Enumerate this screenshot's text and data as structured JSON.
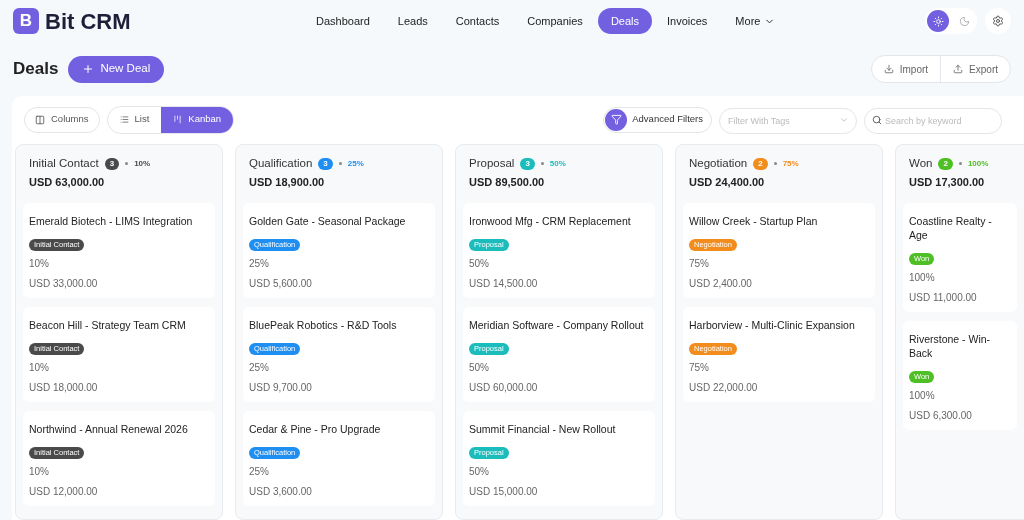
{
  "brand": {
    "logo_letter": "B",
    "name": "Bit CRM"
  },
  "nav": [
    {
      "label": "Dashboard",
      "selected": false
    },
    {
      "label": "Leads",
      "selected": false
    },
    {
      "label": "Contacts",
      "selected": false
    },
    {
      "label": "Companies",
      "selected": false
    },
    {
      "label": "Deals",
      "selected": true
    },
    {
      "label": "Invoices",
      "selected": false
    },
    {
      "label": "More",
      "selected": false,
      "kind": "dropdown"
    }
  ],
  "theme_toggle": [
    {
      "kind": "light",
      "selected": true
    },
    {
      "kind": "dark",
      "selected": false
    }
  ],
  "page_title": "Deals",
  "new_button": "New Deal",
  "actions": [
    "Import",
    "Export"
  ],
  "toolbar": {
    "columns_button": "Columns",
    "views": [
      {
        "label": "List",
        "kind": "list",
        "selected": false
      },
      {
        "label": "Kanban",
        "kind": "kanban",
        "selected": true
      }
    ],
    "advanced_filters": "Advanced Filters",
    "tag_filter": {
      "placeholder": "Filter With Tags"
    },
    "search": {
      "placeholder": "Search by keyword"
    }
  },
  "stages": [
    {
      "name": "Initial Contact",
      "count": "3",
      "probability": "10%",
      "total": "USD 63,000.00",
      "color": "#4a4a4a",
      "deals": [
        {
          "title": "Emerald Biotech - LIMS Integration",
          "stage": "Initial Contact",
          "probability": "10%",
          "amount": "USD 33,000.00"
        },
        {
          "title": "Beacon Hill - Strategy Team CRM",
          "stage": "Initial Contact",
          "probability": "10%",
          "amount": "USD 18,000.00"
        },
        {
          "title": "Northwind - Annual Renewal 2026",
          "stage": "Initial Contact",
          "probability": "10%",
          "amount": "USD 12,000.00"
        }
      ]
    },
    {
      "name": "Qualification",
      "count": "3",
      "probability": "25%",
      "total": "USD 18,900.00",
      "color": "#1e8ef0",
      "deals": [
        {
          "title": "Golden Gate - Seasonal Package",
          "stage": "Qualification",
          "probability": "25%",
          "amount": "USD 5,600.00"
        },
        {
          "title": "BluePeak Robotics - R&D Tools",
          "stage": "Qualification",
          "probability": "25%",
          "amount": "USD 9,700.00"
        },
        {
          "title": "Cedar & Pine - Pro Upgrade",
          "stage": "Qualification",
          "probability": "25%",
          "amount": "USD 3,600.00"
        }
      ]
    },
    {
      "name": "Proposal",
      "count": "3",
      "probability": "50%",
      "total": "USD 89,500.00",
      "color": "#1bbcbc",
      "deals": [
        {
          "title": "Ironwood Mfg - CRM Replacement",
          "stage": "Proposal",
          "probability": "50%",
          "amount": "USD 14,500.00"
        },
        {
          "title": "Meridian Software - Company Rollout",
          "stage": "Proposal",
          "probability": "50%",
          "amount": "USD 60,000.00"
        },
        {
          "title": "Summit Financial - New Rollout",
          "stage": "Proposal",
          "probability": "50%",
          "amount": "USD 15,000.00"
        }
      ]
    },
    {
      "name": "Negotiation",
      "count": "2",
      "probability": "75%",
      "total": "USD 24,400.00",
      "color": "#f28c1c",
      "deals": [
        {
          "title": "Willow Creek - Startup Plan",
          "stage": "Negotiation",
          "probability": "75%",
          "amount": "USD 2,400.00"
        },
        {
          "title": "Harborview - Multi-Clinic Expansion",
          "stage": "Negotiation",
          "probability": "75%",
          "amount": "USD 22,000.00"
        }
      ]
    },
    {
      "name": "Won",
      "count": "2",
      "probability": "100%",
      "total": "USD 17,300.00",
      "color": "#4fbf26",
      "deals": [
        {
          "title": "Coastline Realty - Age",
          "stage": "Won",
          "probability": "100%",
          "amount": "USD 11,000.00"
        },
        {
          "title": "Riverstone - Win-Back",
          "stage": "Won",
          "probability": "100%",
          "amount": "USD 6,300.00"
        }
      ]
    }
  ]
}
